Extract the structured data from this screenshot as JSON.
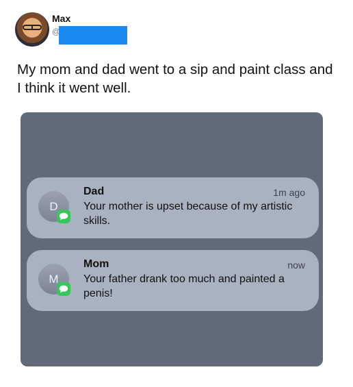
{
  "tweet": {
    "author_name": "Max",
    "author_handle_prefix": "@",
    "text": "My mom and dad went to a sip and paint class and I think it went well."
  },
  "notifications": [
    {
      "avatar_letter": "D",
      "sender": "Dad",
      "time": "1m ago",
      "body": "Your mother is upset because of my artistic skills.",
      "app_icon": "messages-icon"
    },
    {
      "avatar_letter": "M",
      "sender": "Mom",
      "time": "now",
      "body": "Your father drank too much and painted a penis!",
      "app_icon": "messages-icon"
    }
  ],
  "colors": {
    "redaction": "#1b8af1",
    "screenshot_bg": "#616a79",
    "notification_bg": "#a9b2c0",
    "messages_green": "#35c759"
  }
}
